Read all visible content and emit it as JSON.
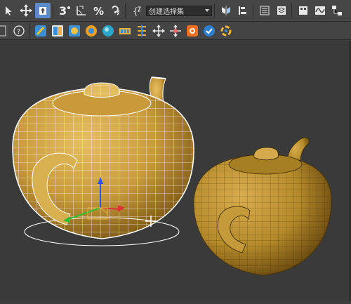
{
  "main_toolbar": {
    "selection_set": {
      "value": "创建选择集",
      "placeholder": "创建选择集"
    },
    "snap_toggle_label": "3",
    "tools": [
      "select-object",
      "select-and-move",
      "select-and-rotate",
      "snaps-toggle",
      "angle-snap",
      "percent-snap",
      "spinner-snap",
      "edit-named-selection",
      "named-selection-sets",
      "mirror",
      "align",
      "toggle-scene-explorer",
      "toggle-layer-explorer",
      "toggle-ribbon",
      "curve-editor",
      "schematic-view"
    ]
  },
  "secondary_toolbar": {
    "tools": [
      "help",
      "paint-deform",
      "graphite-modeling",
      "material-editor",
      "render-setup",
      "environment",
      "array",
      "align-tool",
      "transform-center",
      "pivot",
      "render-frame",
      "render",
      "activeshade"
    ]
  },
  "viewport": {
    "objects": [
      "teapot-selected",
      "teapot-second"
    ],
    "colors": {
      "teapot_fill": "#c89a3c",
      "teapot_dark": "#6d4c12",
      "wire_selected": "#ffffff",
      "wire_unselected": "#2a2008",
      "background": "#3a3a3a"
    }
  }
}
